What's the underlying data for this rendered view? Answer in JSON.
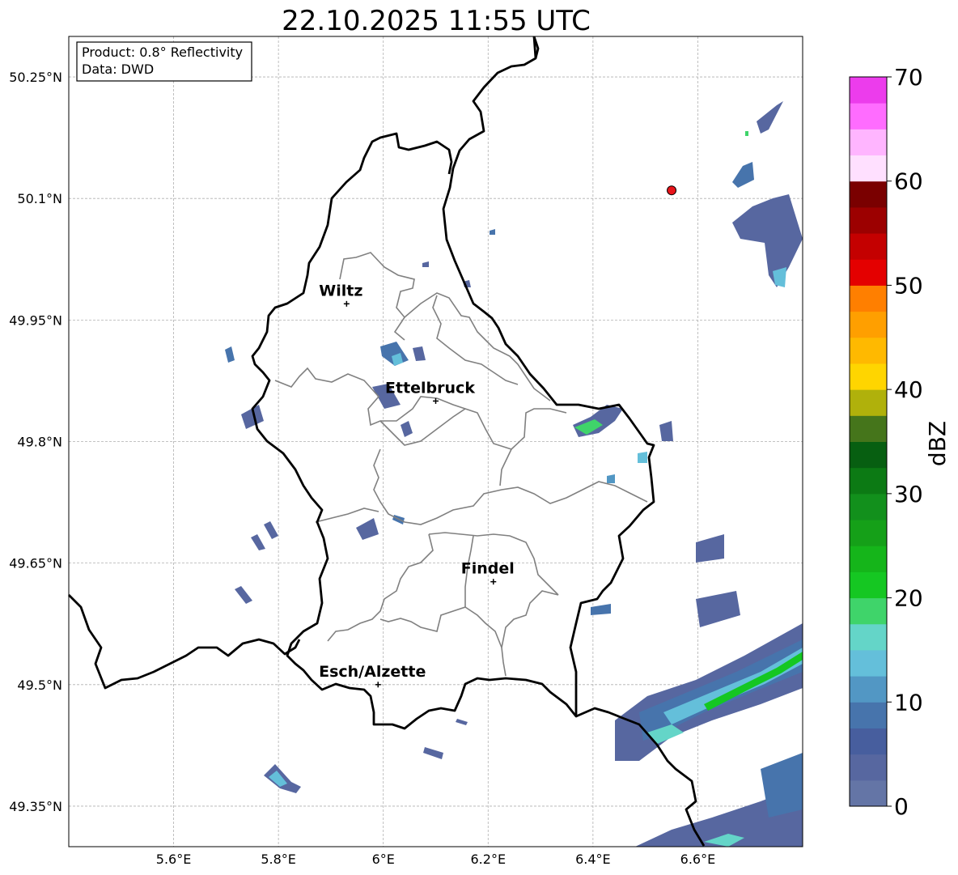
{
  "title": "22.10.2025 11:55 UTC",
  "info": {
    "product": "Product: 0.8° Reflectivity",
    "data": "Data: DWD"
  },
  "lat_ticks": [
    {
      "label": "50.25°N",
      "value": 50.25
    },
    {
      "label": "50.1°N",
      "value": 50.1
    },
    {
      "label": "49.95°N",
      "value": 49.95
    },
    {
      "label": "49.8°N",
      "value": 49.8
    },
    {
      "label": "49.65°N",
      "value": 49.65
    },
    {
      "label": "49.5°N",
      "value": 49.5
    },
    {
      "label": "49.35°N",
      "value": 49.35
    }
  ],
  "lon_ticks": [
    {
      "label": "5.6°E",
      "value": 5.6
    },
    {
      "label": "5.8°E",
      "value": 5.8
    },
    {
      "label": "6°E",
      "value": 6.0
    },
    {
      "label": "6.2°E",
      "value": 6.2
    },
    {
      "label": "6.4°E",
      "value": 6.4
    },
    {
      "label": "6.6°E",
      "value": 6.6
    }
  ],
  "extent": {
    "lon_min": 5.4,
    "lon_max": 6.8,
    "lat_min": 49.3,
    "lat_max": 50.3
  },
  "cities": [
    {
      "name": "Wiltz",
      "lon": 5.93,
      "lat": 49.97
    },
    {
      "name": "Ettelbruck",
      "lon": 6.1,
      "lat": 49.85
    },
    {
      "name": "Findel",
      "lon": 6.21,
      "lat": 49.627
    },
    {
      "name": "Esch/Alzette",
      "lon": 5.99,
      "lat": 49.5
    }
  ],
  "radar_site": {
    "lon": 6.55,
    "lat": 50.11,
    "color": "#e8141a"
  },
  "colorbar": {
    "label": "dBZ",
    "min": 0,
    "max": 70,
    "ticks": [
      "0",
      "10",
      "20",
      "30",
      "40",
      "50",
      "60",
      "70"
    ],
    "colors": [
      "#6475a6",
      "#5767a0",
      "#475e9e",
      "#4774ac",
      "#5297c4",
      "#64bfda",
      "#64d5c8",
      "#3fd46a",
      "#15c722",
      "#15b51a",
      "#15a018",
      "#12901c",
      "#0c7a14",
      "#075f11",
      "#45751b",
      "#b0b10b",
      "#ffd500",
      "#ffb900",
      "#ff9f00",
      "#ff7f00",
      "#e40000",
      "#c40000",
      "#9c0000",
      "#7a0000",
      "#ffe0ff",
      "#ffb5ff",
      "#ff6cff",
      "#ec3cec"
    ]
  }
}
